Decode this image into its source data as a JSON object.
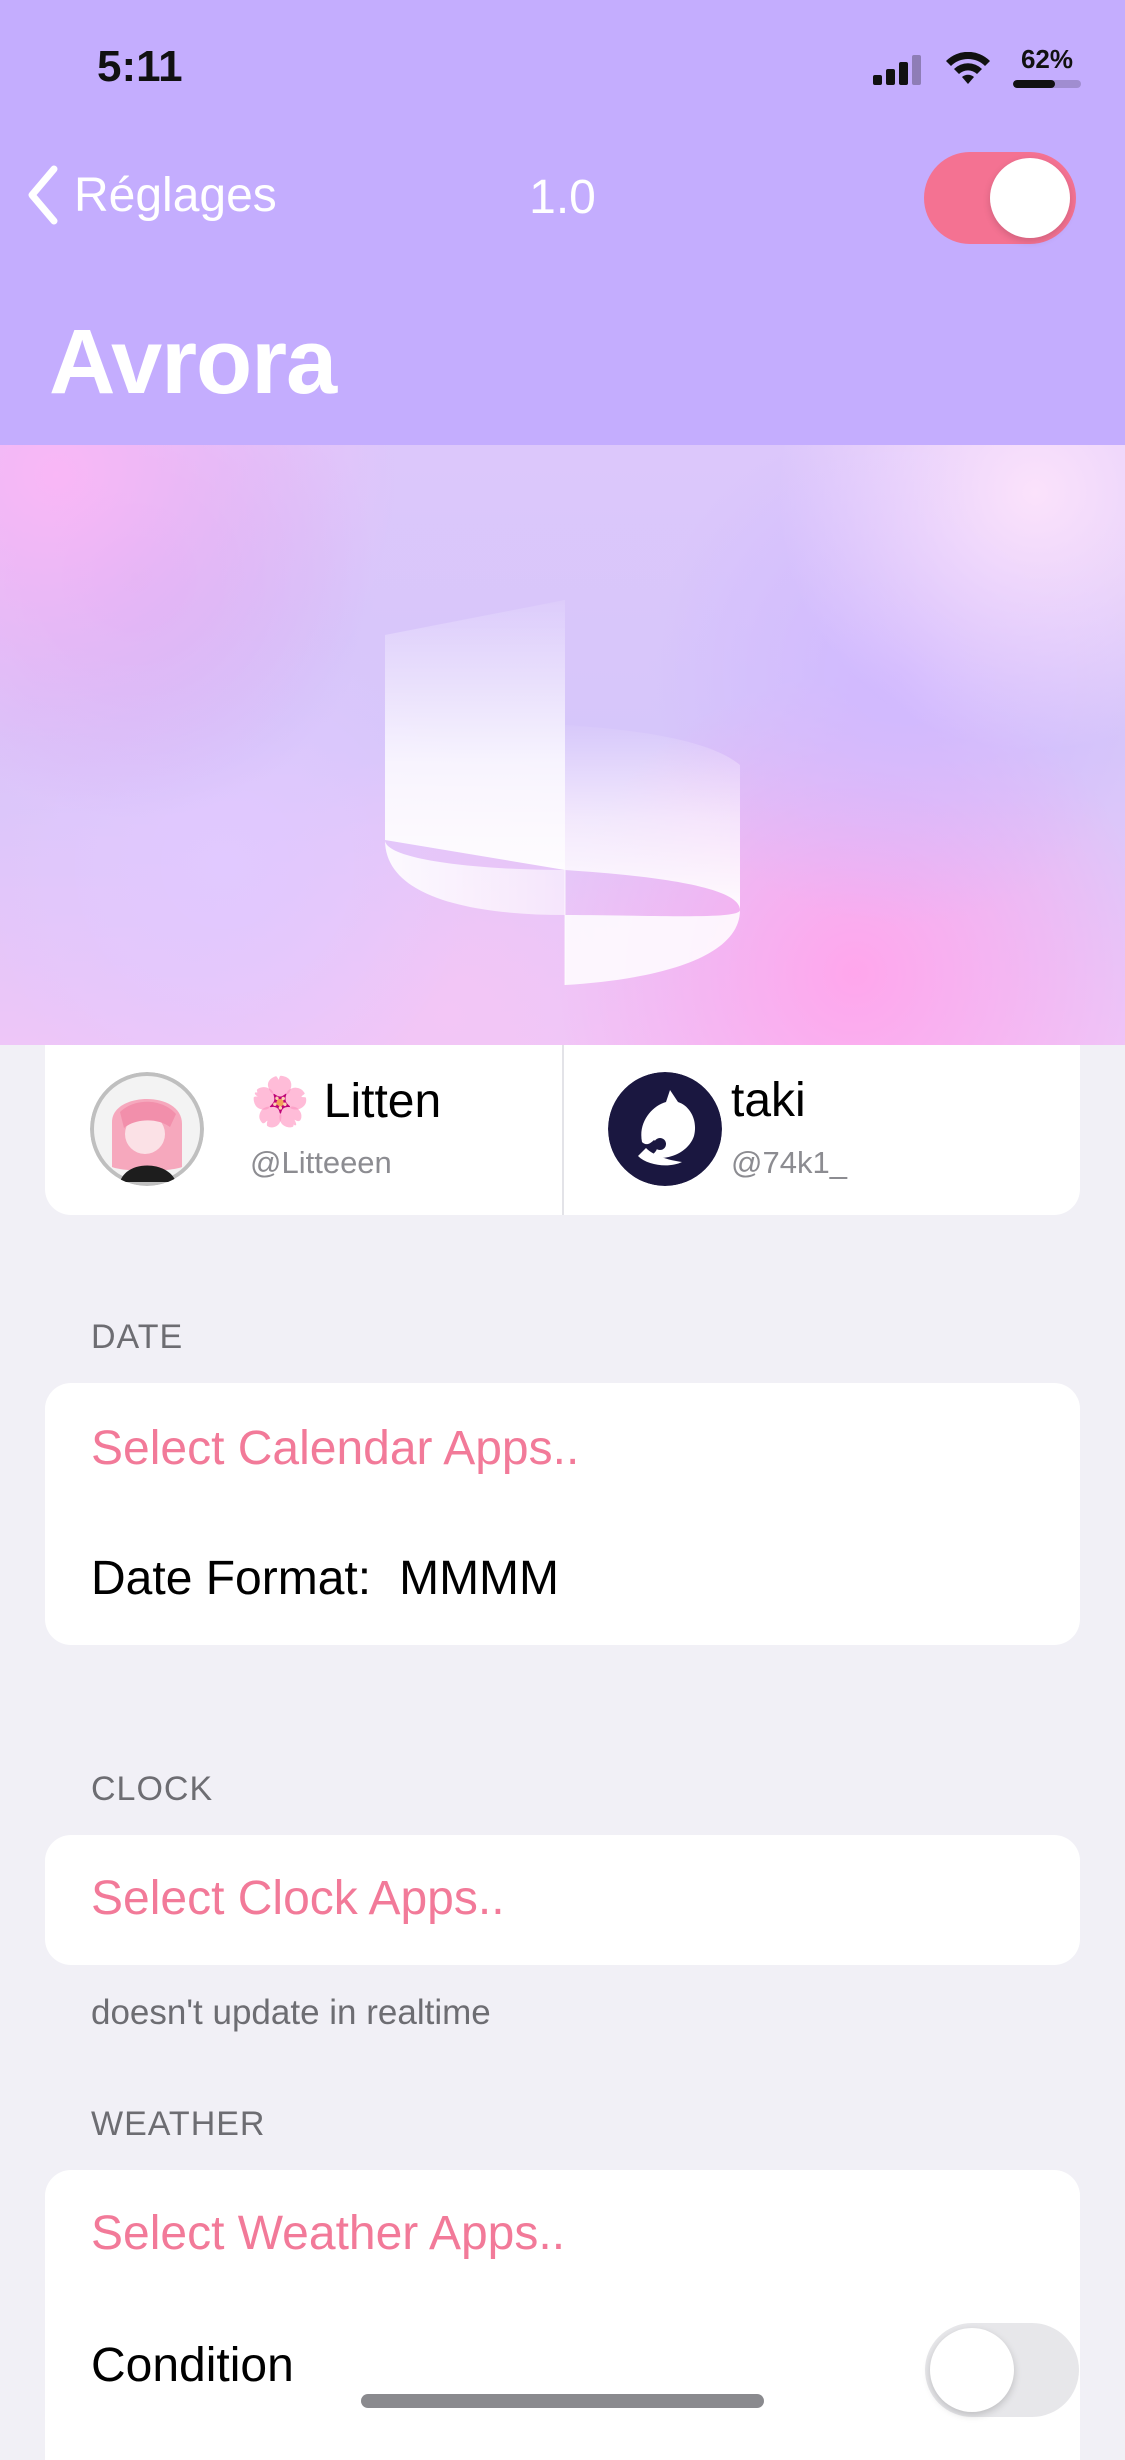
{
  "status_bar": {
    "time": "5:11",
    "battery_percent": "62%",
    "battery_level": 0.62
  },
  "nav": {
    "back_label": "Réglages",
    "version": "1.0",
    "enabled": true
  },
  "page": {
    "title": "Avrora"
  },
  "credits": [
    {
      "emoji": "🌸",
      "name": "Litten",
      "handle": "@Litteeen"
    },
    {
      "name": "taki",
      "handle": "@74k1_"
    }
  ],
  "sections": {
    "date": {
      "header": "DATE",
      "select_label": "Select Calendar Apps..",
      "format_label": "Date Format:",
      "format_value": "MMMM"
    },
    "clock": {
      "header": "CLOCK",
      "select_label": "Select Clock Apps..",
      "footer": "doesn't update in realtime"
    },
    "weather": {
      "header": "WEATHER",
      "select_label": "Select Weather Apps..",
      "condition_label": "Condition",
      "condition_enabled": false
    }
  },
  "colors": {
    "header": "#c4adfe",
    "accent": "#f27a99",
    "toggle_on": "#f47292"
  },
  "icons": [
    "back-chevron-icon",
    "cellular-signal-icon",
    "wifi-icon",
    "battery-icon",
    "avrora-logo"
  ]
}
